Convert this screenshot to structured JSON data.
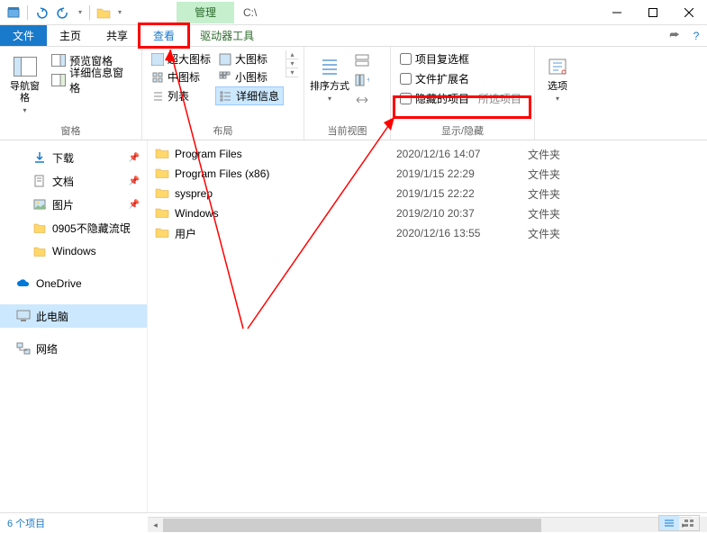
{
  "title_path": "C:\\",
  "context_tab": "管理",
  "tabs": {
    "file": "文件",
    "home": "主页",
    "share": "共享",
    "view": "查看",
    "drive": "驱动器工具"
  },
  "ribbon": {
    "panes_group": "窗格",
    "nav_pane": "导航窗格",
    "preview_pane": "预览窗格",
    "details_pane": "详细信息窗格",
    "layout_group": "布局",
    "layout": {
      "xl": "超大图标",
      "l": "大图标",
      "m": "中图标",
      "s": "小图标",
      "list": "列表",
      "details": "详细信息"
    },
    "view_group": "当前视图",
    "sort": "排序方式",
    "showhide_group": "显示/隐藏",
    "chk_checkboxes": "项目复选框",
    "chk_ext": "文件扩展名",
    "chk_hidden": "隐藏的项目",
    "selected_items": "所选项目",
    "options": "选项"
  },
  "sidebar": {
    "downloads": "下载",
    "documents": "文档",
    "pictures": "图片",
    "folder1": "0905不隐藏流氓",
    "folder2": "Windows",
    "onedrive": "OneDrive",
    "thispc": "此电脑",
    "network": "网络"
  },
  "files": [
    {
      "name": "Program Files",
      "date": "2020/12/16 14:07",
      "type": "文件夹"
    },
    {
      "name": "Program Files (x86)",
      "date": "2019/1/15 22:29",
      "type": "文件夹"
    },
    {
      "name": "sysprep",
      "date": "2019/1/15 22:22",
      "type": "文件夹"
    },
    {
      "name": "Windows",
      "date": "2019/2/10 20:37",
      "type": "文件夹"
    },
    {
      "name": "用户",
      "date": "2020/12/16 13:55",
      "type": "文件夹"
    }
  ],
  "status": "6 个项目"
}
